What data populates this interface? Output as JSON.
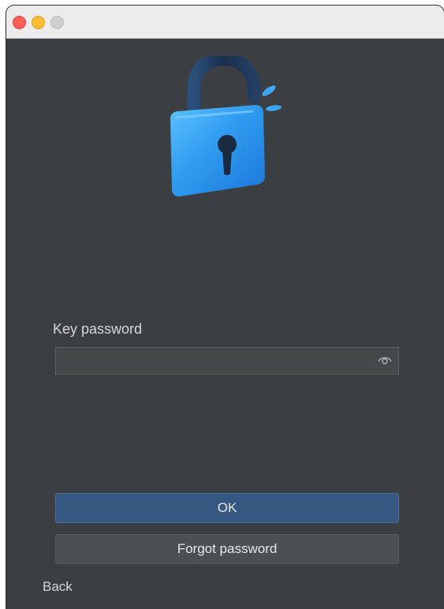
{
  "window": {
    "controls": [
      "close",
      "minimize",
      "maximize"
    ]
  },
  "header": {
    "icon": "unlocked-padlock-icon"
  },
  "form": {
    "password_label": "Key password",
    "password_value": "",
    "password_placeholder": "",
    "reveal_icon": "eye-icon"
  },
  "actions": {
    "ok_label": "OK",
    "forgot_label": "Forgot password",
    "back_label": "Back"
  },
  "colors": {
    "background": "#3c3f41",
    "primary_button": "#365880",
    "secondary_button": "#4c5052",
    "lock_blue": "#2f9bf0",
    "shackle_dark": "#1e3a5f"
  }
}
